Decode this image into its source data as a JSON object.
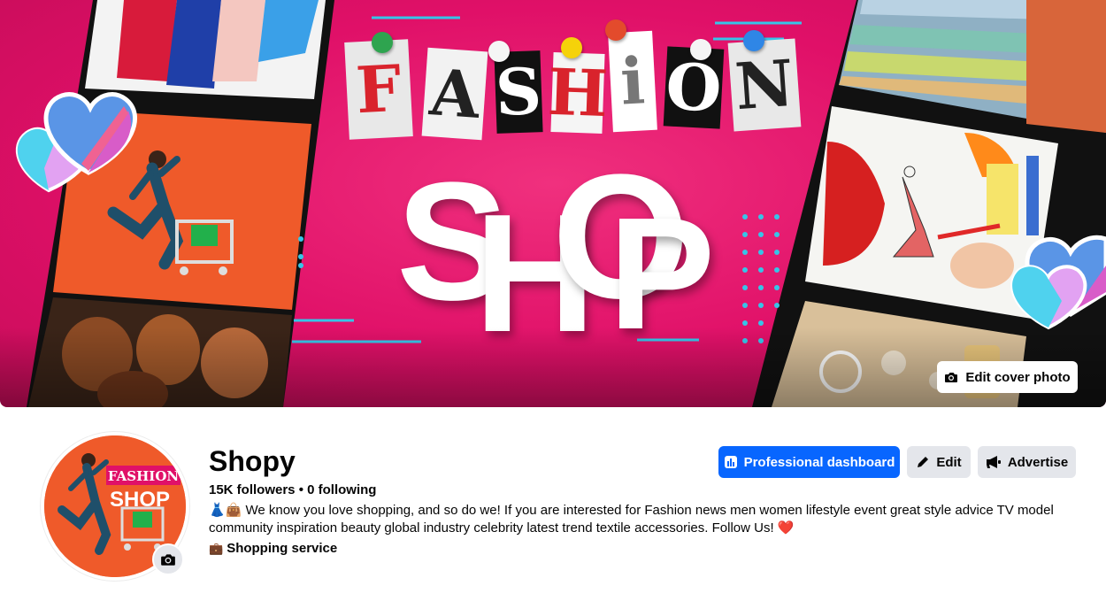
{
  "cover": {
    "title_top": [
      "F",
      "A",
      "S",
      "H",
      "i",
      "O",
      "N"
    ],
    "title_bottom": [
      "S",
      "H",
      "O",
      "P"
    ],
    "edit_cover_label": "Edit cover photo",
    "accent_pink": "#e01068",
    "accent_cyan": "#36c5e8"
  },
  "avatar": {
    "logo_top": "FASHION",
    "logo_bottom": "SHOP"
  },
  "profile": {
    "name": "Shopy",
    "stats": "15K followers • 0 following",
    "bio_emoji": "👗👜",
    "bio_text": "We know you love shopping, and so do we! If you are interested for Fashion news men women lifestyle event great style advice TV model community inspiration beauty global industry celebrity latest trend textile accessories. Follow Us!",
    "bio_heart": "❤️",
    "category_icon": "💼",
    "category": "Shopping service"
  },
  "actions": {
    "dashboard_label": "Professional dashboard",
    "edit_label": "Edit",
    "advertise_label": "Advertise"
  },
  "colors": {
    "primary_blue": "#0866ff",
    "secondary_gray": "#e4e6eb",
    "text": "#050505"
  }
}
